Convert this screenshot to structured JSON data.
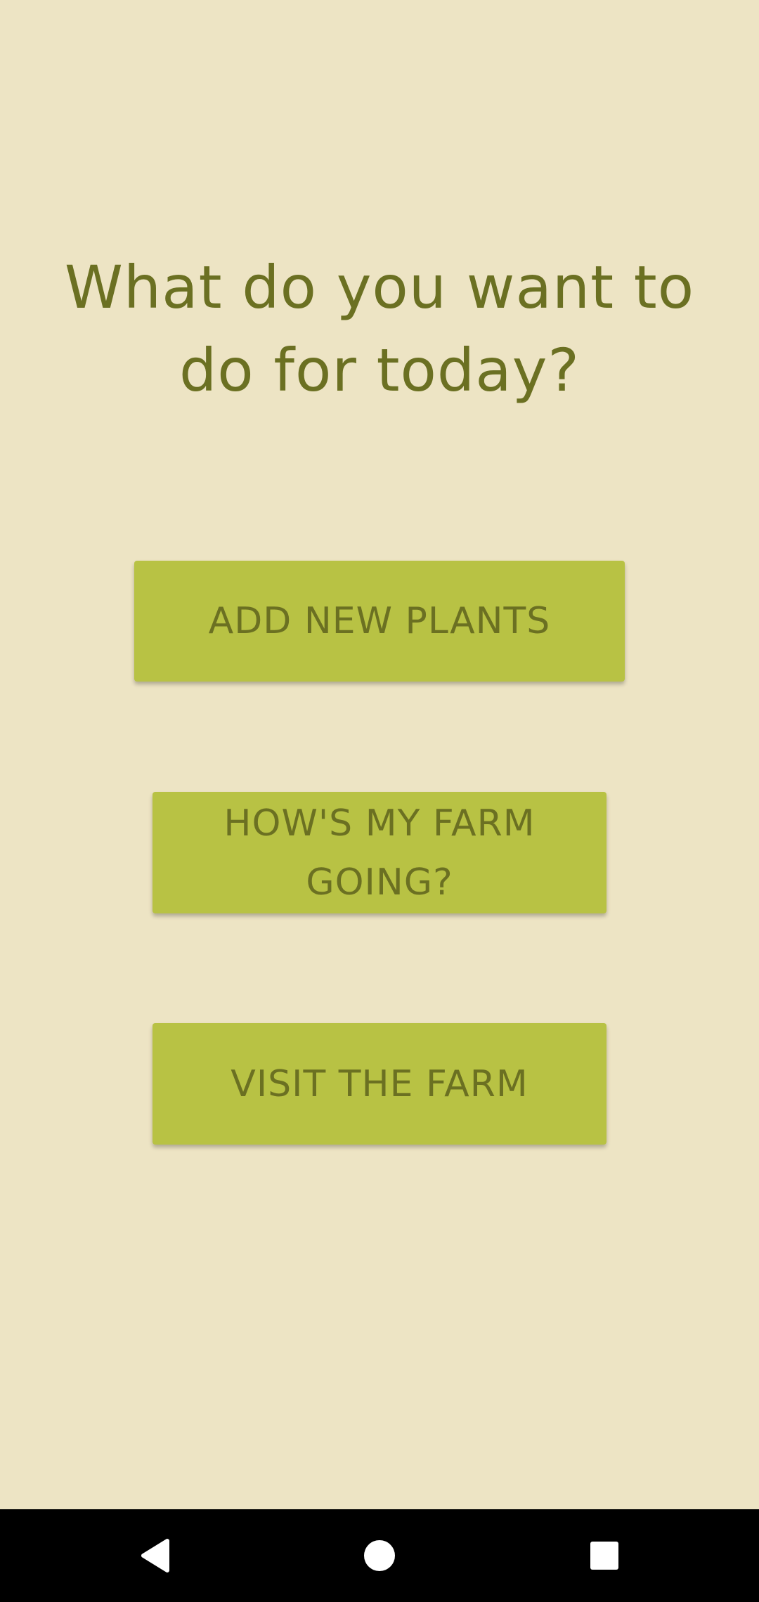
{
  "screen": {
    "title": "What do you want to do for today?",
    "background_color": "#ede4c4",
    "text_color": "#6b7022",
    "button_color": "#b8c244"
  },
  "buttons": {
    "add_new_plants": "ADD NEW PLANTS",
    "hows_my_farm": "HOW'S MY FARM GOING?",
    "visit_farm": "VISIT THE FARM"
  },
  "navbar": {
    "back_icon": "back-triangle-icon",
    "home_icon": "home-circle-icon",
    "recents_icon": "recents-square-icon"
  }
}
